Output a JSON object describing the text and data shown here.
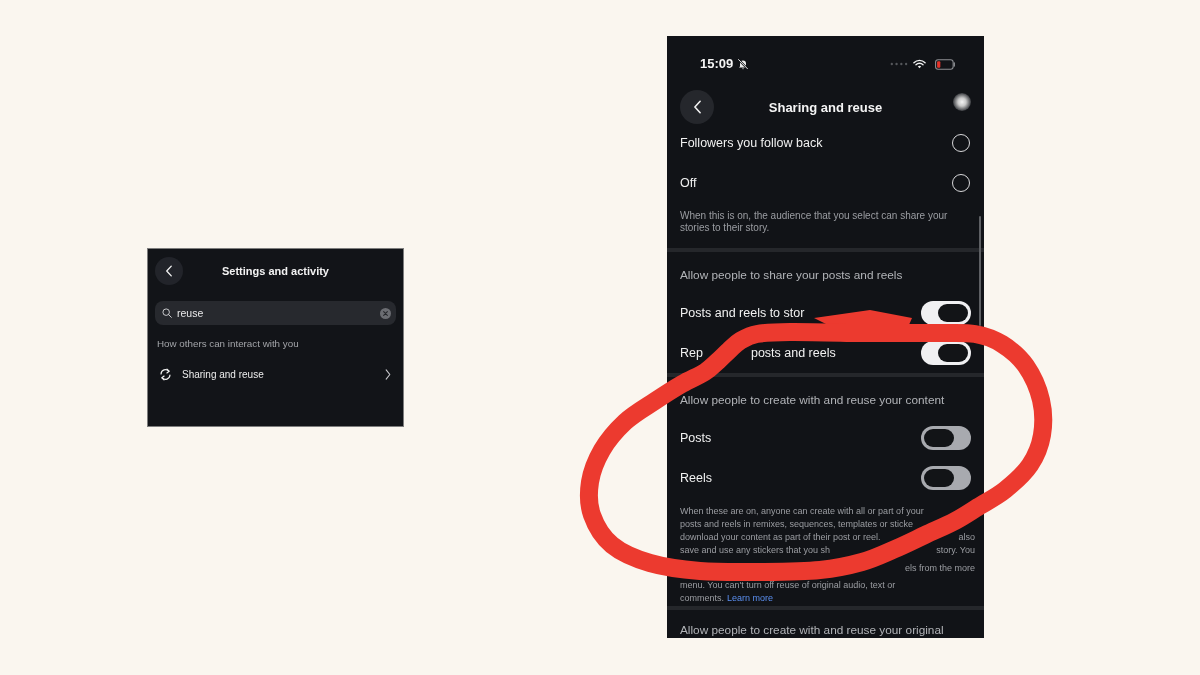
{
  "settings_panel": {
    "title": "Settings and activity",
    "search": {
      "value": "reuse"
    },
    "section_label": "How others can interact with you",
    "results": [
      {
        "label": "Sharing and reuse"
      }
    ]
  },
  "phone": {
    "status_bar": {
      "time": "15:09"
    },
    "title": "Sharing and reuse",
    "audience_options": [
      {
        "label": "Followers you follow back",
        "selected": false
      },
      {
        "label": "Off",
        "selected": false
      }
    ],
    "audience_note": "When this is on, the audience that you select can share your stories to their story.",
    "sections": [
      {
        "header": "Allow people to share your posts and reels",
        "toggles": [
          {
            "label_parts": [
              "Posts and reels to stor"
            ],
            "on": true
          },
          {
            "label_parts": [
              "Rep",
              "posts and reels"
            ],
            "on": true
          }
        ]
      },
      {
        "header": "Allow people to create with and reuse your content",
        "toggles": [
          {
            "label_parts": [
              "Posts"
            ],
            "on": false
          },
          {
            "label_parts": [
              "Reels"
            ],
            "on": false
          }
        ],
        "note_lines": [
          {
            "start": "When these are on, anyone can create with all or part of your"
          },
          {
            "start": "posts and reels in remixes, sequences, templates or sticke"
          },
          {
            "start": "download your content as part of their post or reel.",
            "end": "also"
          },
          {
            "start": "save and use any stickers that you sh",
            "end": "story. You"
          },
          {
            "end": "els from the more"
          },
          {
            "start": "menu. You can't turn off reuse of original audio, text or"
          },
          {
            "start": "comments.",
            "link": "Learn more"
          }
        ]
      },
      {
        "header": "Allow people to create with and reuse your original"
      }
    ]
  },
  "annotation": {
    "kind": "loop"
  }
}
